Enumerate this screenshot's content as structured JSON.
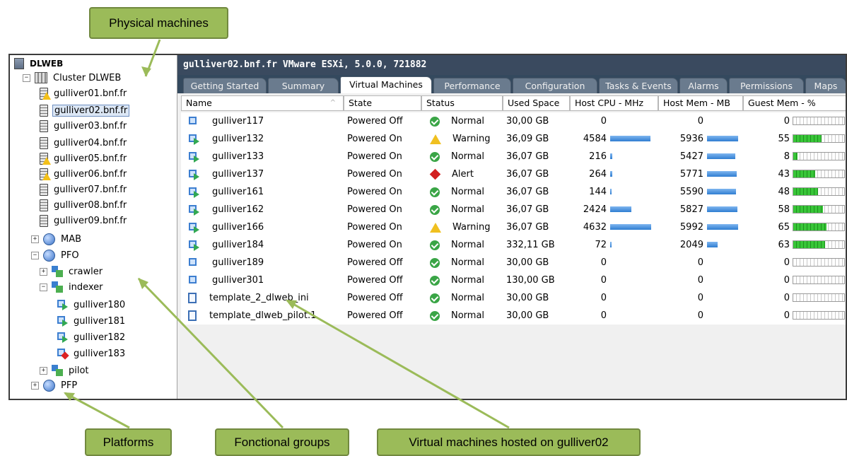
{
  "callouts": {
    "physical": "Physical machines",
    "platforms": "Platforms",
    "functional": "Fonctional groups",
    "vms": "Virtual machines hosted on gulliver02"
  },
  "tree": [
    {
      "label": "DLWEB",
      "icon": "datacenter-icon",
      "expander": "",
      "bold": true
    },
    {
      "label": "Cluster DLWEB",
      "icon": "cluster-icon",
      "expander": "−"
    },
    {
      "label": "gulliver01.bnf.fr",
      "icon": "host-warning-icon",
      "expander": ""
    },
    {
      "label": "gulliver02.bnf.fr",
      "icon": "host-icon",
      "expander": "",
      "selected": true
    },
    {
      "label": "gulliver03.bnf.fr",
      "icon": "host-icon",
      "expander": ""
    },
    {
      "label": "gulliver04.bnf.fr",
      "icon": "host-icon",
      "expander": ""
    },
    {
      "label": "gulliver05.bnf.fr",
      "icon": "host-warning-icon",
      "expander": ""
    },
    {
      "label": "gulliver06.bnf.fr",
      "icon": "host-warning-icon",
      "expander": ""
    },
    {
      "label": "gulliver07.bnf.fr",
      "icon": "host-icon",
      "expander": ""
    },
    {
      "label": "gulliver08.bnf.fr",
      "icon": "host-icon",
      "expander": ""
    },
    {
      "label": "gulliver09.bnf.fr",
      "icon": "host-icon",
      "expander": ""
    },
    {
      "label": "MAB",
      "icon": "platform-icon",
      "expander": "+"
    },
    {
      "label": "PFO",
      "icon": "platform-icon",
      "expander": "−"
    },
    {
      "label": "crawler",
      "icon": "vapp-icon",
      "expander": "+"
    },
    {
      "label": "indexer",
      "icon": "vapp-icon",
      "expander": "−"
    },
    {
      "label": "gulliver180",
      "icon": "vm-on-icon",
      "expander": ""
    },
    {
      "label": "gulliver181",
      "icon": "vm-on-icon",
      "expander": ""
    },
    {
      "label": "gulliver182",
      "icon": "vm-on-icon",
      "expander": ""
    },
    {
      "label": "gulliver183",
      "icon": "vm-alert-icon",
      "expander": ""
    },
    {
      "label": "pilot",
      "icon": "vapp-icon",
      "expander": "+"
    },
    {
      "label": "PFP",
      "icon": "platform-icon",
      "expander": "+"
    }
  ],
  "window_title": "gulliver02.bnf.fr VMware ESXi, 5.0.0, 721882",
  "tabs": [
    "Getting Started",
    "Summary",
    "Virtual Machines",
    "Performance",
    "Configuration",
    "Tasks & Events",
    "Alarms",
    "Permissions",
    "Maps"
  ],
  "active_tab": "Virtual Machines",
  "columns": [
    "Name",
    "State",
    "Status",
    "Used Space",
    "Host CPU - MHz",
    "Host Mem - MB",
    "Guest Mem - %"
  ],
  "sort_indicator": "^",
  "rows": [
    {
      "name": "gulliver117",
      "icon": "vm-off-icon",
      "state": "Powered Off",
      "status": "Normal",
      "used": "30,00 GB",
      "cpu": "0",
      "mem": "0",
      "guest": "0",
      "cpu_frac": 0,
      "mem_frac": 0,
      "guest_frac": 0
    },
    {
      "name": "gulliver132",
      "icon": "vm-on-icon",
      "state": "Powered On",
      "status": "Warning",
      "used": "36,09 GB",
      "cpu": "4584",
      "mem": "5936",
      "guest": "55",
      "cpu_frac": 0.99,
      "mem_frac": 0.99,
      "guest_frac": 0.55
    },
    {
      "name": "gulliver133",
      "icon": "vm-on-icon",
      "state": "Powered On",
      "status": "Normal",
      "used": "36,07 GB",
      "cpu": "216",
      "mem": "5427",
      "guest": "8",
      "cpu_frac": 0.05,
      "mem_frac": 0.91,
      "guest_frac": 0.08
    },
    {
      "name": "gulliver137",
      "icon": "vm-on-icon",
      "state": "Powered On",
      "status": "Alert",
      "used": "36,07 GB",
      "cpu": "264",
      "mem": "5771",
      "guest": "43",
      "cpu_frac": 0.06,
      "mem_frac": 0.96,
      "guest_frac": 0.43
    },
    {
      "name": "gulliver161",
      "icon": "vm-on-icon",
      "state": "Powered On",
      "status": "Normal",
      "used": "36,07 GB",
      "cpu": "144",
      "mem": "5590",
      "guest": "48",
      "cpu_frac": 0.03,
      "mem_frac": 0.93,
      "guest_frac": 0.48
    },
    {
      "name": "gulliver162",
      "icon": "vm-on-icon",
      "state": "Powered On",
      "status": "Normal",
      "used": "36,07 GB",
      "cpu": "2424",
      "mem": "5827",
      "guest": "58",
      "cpu_frac": 0.52,
      "mem_frac": 0.97,
      "guest_frac": 0.58
    },
    {
      "name": "gulliver166",
      "icon": "vm-on-icon",
      "state": "Powered On",
      "status": "Warning",
      "used": "36,07 GB",
      "cpu": "4632",
      "mem": "5992",
      "guest": "65",
      "cpu_frac": 1.0,
      "mem_frac": 1.0,
      "guest_frac": 0.65
    },
    {
      "name": "gulliver184",
      "icon": "vm-on-icon",
      "state": "Powered On",
      "status": "Normal",
      "used": "332,11 GB",
      "cpu": "72",
      "mem": "2049",
      "guest": "63",
      "cpu_frac": 0.02,
      "mem_frac": 0.34,
      "guest_frac": 0.63
    },
    {
      "name": "gulliver189",
      "icon": "vm-off-icon",
      "state": "Powered Off",
      "status": "Normal",
      "used": "30,00 GB",
      "cpu": "0",
      "mem": "0",
      "guest": "0",
      "cpu_frac": 0,
      "mem_frac": 0,
      "guest_frac": 0
    },
    {
      "name": "gulliver301",
      "icon": "vm-off-icon",
      "state": "Powered Off",
      "status": "Normal",
      "used": "130,00 GB",
      "cpu": "0",
      "mem": "0",
      "guest": "0",
      "cpu_frac": 0,
      "mem_frac": 0,
      "guest_frac": 0
    },
    {
      "name": "template_2_dlweb_ini",
      "icon": "template-icon",
      "state": "Powered Off",
      "status": "Normal",
      "used": "30,00 GB",
      "cpu": "0",
      "mem": "0",
      "guest": "0",
      "cpu_frac": 0,
      "mem_frac": 0,
      "guest_frac": 0
    },
    {
      "name": "template_dlweb_pilot.1",
      "icon": "template-icon",
      "state": "Powered Off",
      "status": "Normal",
      "used": "30,00 GB",
      "cpu": "0",
      "mem": "0",
      "guest": "0",
      "cpu_frac": 0,
      "mem_frac": 0,
      "guest_frac": 0
    }
  ]
}
